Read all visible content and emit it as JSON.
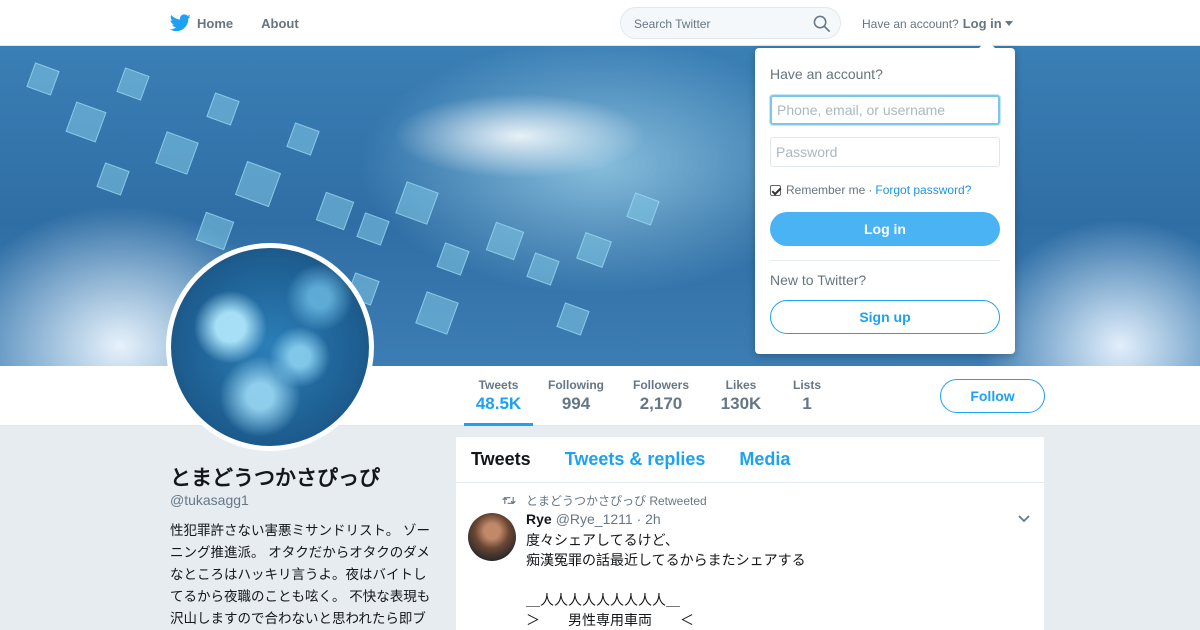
{
  "nav": {
    "home_label": "Home",
    "about_label": "About",
    "search_placeholder": "Search Twitter",
    "have_account": "Have an account?",
    "login_label": "Log in"
  },
  "profile": {
    "name": "とまどうつかさぴっぴ",
    "handle": "@tukasagg1",
    "bio": "性犯罪許さない害悪ミサンドリスト。 ゾーニング推進派。 オタクだからオタクのダメなところはハッキリ言うよ。夜はバイトしてるから夜職のことも呟く。 不快な表現も沢山しますので合わないと思われたら即ブロック推奨です。"
  },
  "stats": [
    {
      "label": "Tweets",
      "value": "48.5K"
    },
    {
      "label": "Following",
      "value": "994"
    },
    {
      "label": "Followers",
      "value": "2,170"
    },
    {
      "label": "Likes",
      "value": "130K"
    },
    {
      "label": "Lists",
      "value": "1"
    }
  ],
  "follow_label": "Follow",
  "timeline": {
    "tabs": [
      "Tweets",
      "Tweets & replies",
      "Media"
    ],
    "retweet_context": "とまどうつかさぴっぴ Retweeted",
    "tweet": {
      "name": "Rye",
      "meta": "@Rye_1211 · 2h",
      "text": "度々シェアしてるけど、\n痴漢冤罪の話最近してるからまたシェアする\n\n＿人人人人人人人人人＿\n＞　　男性専用車両　　＜"
    }
  },
  "login_dropdown": {
    "title": "Have an account?",
    "username_placeholder": "Phone, email, or username",
    "password_placeholder": "Password",
    "remember_label": "Remember me",
    "separator": "·",
    "forgot_label": "Forgot password?",
    "login_button": "Log in",
    "new_label": "New to Twitter?",
    "signup_button": "Sign up"
  },
  "colors": {
    "accent": "#1da1f2",
    "login_button": "#4ab3f4",
    "banner": "#2f6ea5"
  }
}
